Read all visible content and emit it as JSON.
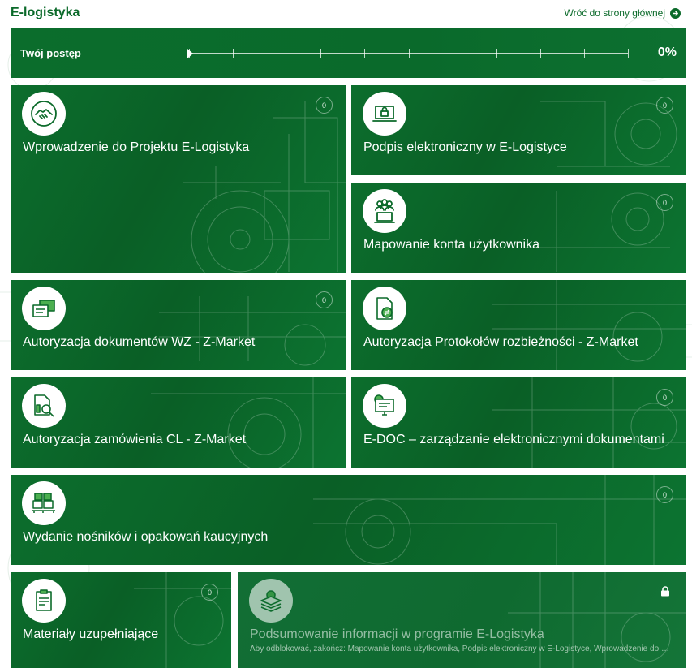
{
  "header": {
    "title": "E-logistyka",
    "back_label": "Wróć do strony głównej"
  },
  "progress": {
    "label": "Twój postęp",
    "value_percent": 0,
    "value_label": "0%"
  },
  "colors": {
    "brand_green": "#0b6a2a",
    "tile_green": "#0c6e2d",
    "white": "#ffffff"
  },
  "tiles": [
    {
      "title": "Wprowadzenie do Projektu E-Logistyka",
      "count": "0",
      "icon": "handshake-icon"
    },
    {
      "title": "Podpis elektroniczny w E-Logistyce",
      "count": "0",
      "icon": "laptop-lock-icon"
    },
    {
      "title": "Mapowanie konta użytkownika",
      "count": "0",
      "icon": "users-laptop-icon"
    },
    {
      "title": "Autoryzacja dokumentów WZ - Z-Market",
      "count": "0",
      "icon": "documents-icon"
    },
    {
      "title": "Autoryzacja Protokołów rozbieżności - Z-Market",
      "count": "0",
      "icon": "document-exchange-icon"
    },
    {
      "title": "Autoryzacja zamówienia CL - Z-Market",
      "count": "0",
      "icon": "document-search-icon"
    },
    {
      "title": "E-DOC – zarządzanie elektronicznymi dokumentami",
      "count": "0",
      "icon": "monitor-icon"
    },
    {
      "title": "Wydanie nośników i opakowań kaucyjnych",
      "count": "0",
      "icon": "crates-icon"
    },
    {
      "title": "Materiały uzupełniające",
      "count": "0",
      "icon": "clipboard-icon"
    },
    {
      "title": "Podsumowanie informacji w programie E-Logistyka",
      "subtitle": "Aby odblokować, zakończ: Mapowanie konta użytkownika, Podpis elektroniczny w E-Logistyce, Wprowadzenie do Projektu E-Logistyka",
      "locked": true,
      "icon": "layers-gear-icon"
    }
  ]
}
